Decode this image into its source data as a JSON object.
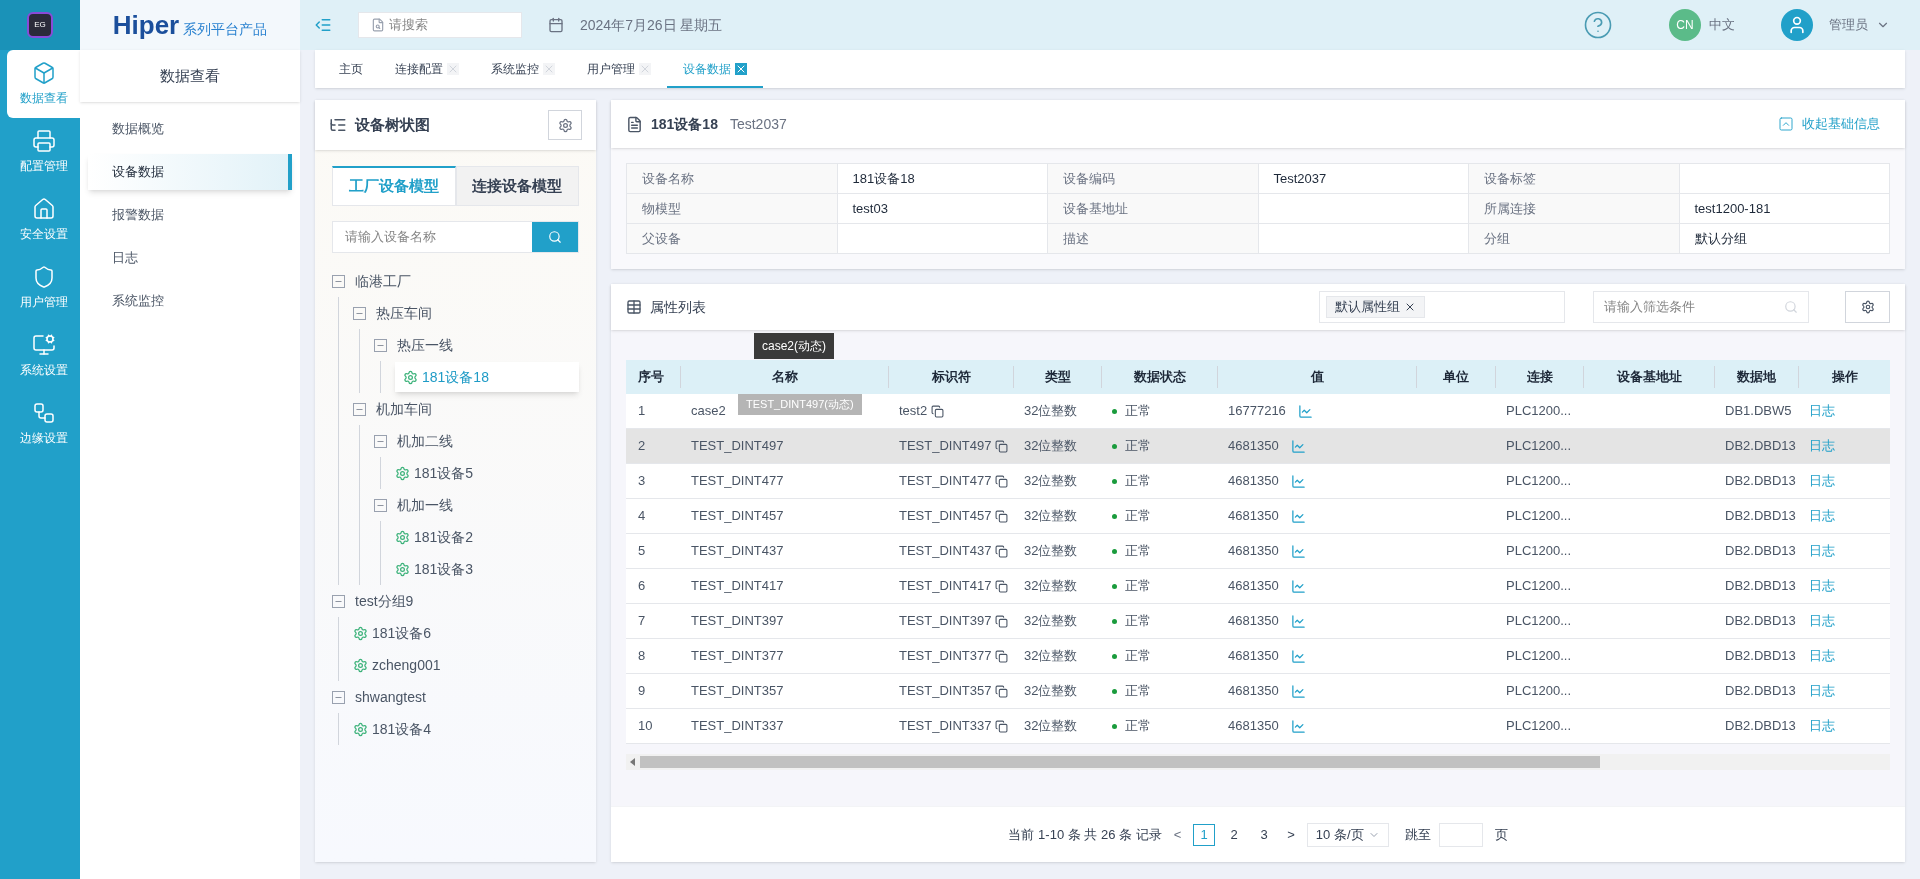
{
  "app_logo": {
    "text": "EG"
  },
  "brand": {
    "name": "Hiper",
    "subtitle": "系列平台产品"
  },
  "rail": [
    {
      "label": "数据查看",
      "selected": true
    },
    {
      "label": "配置管理",
      "selected": false
    },
    {
      "label": "安全设置",
      "selected": false
    },
    {
      "label": "用户管理",
      "selected": false
    },
    {
      "label": "系统设置",
      "selected": false
    },
    {
      "label": "边缘设置",
      "selected": false
    }
  ],
  "sidebar": {
    "title": "数据查看",
    "items": [
      {
        "label": "数据概览",
        "selected": false
      },
      {
        "label": "设备数据",
        "selected": true
      },
      {
        "label": "报警数据",
        "selected": false
      },
      {
        "label": "日志",
        "selected": false
      },
      {
        "label": "系统监控",
        "selected": false
      }
    ]
  },
  "top_bar": {
    "search": {
      "placeholder": "请搜索"
    },
    "date": "2024年7月26日 星期五",
    "language": {
      "badge": "CN",
      "label": "中文"
    },
    "user": "管理员"
  },
  "tabs": [
    {
      "label": "主页",
      "closable": false,
      "selected": false
    },
    {
      "label": "连接配置",
      "closable": true,
      "selected": false
    },
    {
      "label": "系统监控",
      "closable": true,
      "selected": false
    },
    {
      "label": "用户管理",
      "closable": true,
      "selected": false
    },
    {
      "label": "设备数据",
      "closable": true,
      "selected": true
    }
  ],
  "tree_panel": {
    "title": "设备树状图",
    "tabs": [
      {
        "label": "工厂设备模型",
        "selected": true
      },
      {
        "label": "连接设备模型",
        "selected": false
      }
    ],
    "search": {
      "placeholder": "请输入设备名称"
    },
    "tree": [
      {
        "label": "临港工厂",
        "kind": "group",
        "expanded": true,
        "selected": false,
        "children": [
          {
            "label": "热压车间",
            "kind": "group",
            "expanded": true,
            "selected": false,
            "children": [
              {
                "label": "热压一线",
                "kind": "group",
                "expanded": true,
                "selected": false,
                "children": [
                  {
                    "label": "181设备18",
                    "kind": "device",
                    "selected": true
                  }
                ]
              }
            ]
          },
          {
            "label": "机加车间",
            "kind": "group",
            "expanded": true,
            "selected": false,
            "children": [
              {
                "label": "机加二线",
                "kind": "group",
                "expanded": true,
                "selected": false,
                "children": [
                  {
                    "label": "181设备5",
                    "kind": "device",
                    "selected": false
                  }
                ]
              },
              {
                "label": "机加一线",
                "kind": "group",
                "expanded": true,
                "selected": false,
                "children": [
                  {
                    "label": "181设备2",
                    "kind": "device",
                    "selected": false
                  },
                  {
                    "label": "181设备3",
                    "kind": "device",
                    "selected": false
                  }
                ]
              }
            ]
          }
        ]
      },
      {
        "label": "test分组9",
        "kind": "group",
        "expanded": true,
        "selected": false,
        "children": [
          {
            "label": "181设备6",
            "kind": "device",
            "selected": false
          },
          {
            "label": "zcheng001",
            "kind": "device",
            "selected": false
          }
        ]
      },
      {
        "label": "shwangtest",
        "kind": "group",
        "expanded": true,
        "selected": false,
        "children": [
          {
            "label": "181设备4",
            "kind": "device",
            "selected": false
          }
        ]
      }
    ]
  },
  "device_info": {
    "title": "181设备18",
    "code": "Test2037",
    "collapse_label": "收起基础信息",
    "rows": [
      [
        {
          "label": "设备名称",
          "value": "181设备18"
        },
        {
          "label": "设备编码",
          "value": "Test2037"
        },
        {
          "label": "设备标签"
        }
      ],
      [
        {
          "label": "物模型",
          "value": "test03"
        },
        {
          "label": "设备基地址"
        },
        {
          "label": "所属连接",
          "value": "test1200-181"
        }
      ],
      [
        {
          "label": "父设备"
        },
        {
          "label": "描述"
        },
        {
          "label": "分组",
          "value": "默认分组"
        }
      ]
    ]
  },
  "properties": {
    "title": "属性列表",
    "group_tag": "默认属性组",
    "filter": {
      "placeholder": "请输入筛选条件"
    },
    "columns": [
      "序号",
      "名称",
      "标识符",
      "类型",
      "数据状态",
      "值",
      "单位",
      "连接",
      "设备基地址",
      "数据地",
      "操作"
    ],
    "tooltips": [
      "case2(动态)",
      "TEST_DINT497(动态)"
    ],
    "rows": [
      {
        "index": "1",
        "name": "case2",
        "identifier": "test2",
        "type": "32位整数",
        "status": "正常",
        "value": "16777216",
        "connection": "PLC1200...",
        "address": "DB1.DBW5",
        "action": "日志",
        "highlighted": false
      },
      {
        "index": "2",
        "name": "TEST_DINT497",
        "identifier": "TEST_DINT497",
        "type": "32位整数",
        "status": "正常",
        "value": "4681350",
        "connection": "PLC1200...",
        "address": "DB2.DBD13",
        "action": "日志",
        "highlighted": true
      },
      {
        "index": "3",
        "name": "TEST_DINT477",
        "identifier": "TEST_DINT477",
        "type": "32位整数",
        "status": "正常",
        "value": "4681350",
        "connection": "PLC1200...",
        "address": "DB2.DBD13",
        "action": "日志",
        "highlighted": false
      },
      {
        "index": "4",
        "name": "TEST_DINT457",
        "identifier": "TEST_DINT457",
        "type": "32位整数",
        "status": "正常",
        "value": "4681350",
        "connection": "PLC1200...",
        "address": "DB2.DBD13",
        "action": "日志",
        "highlighted": false
      },
      {
        "index": "5",
        "name": "TEST_DINT437",
        "identifier": "TEST_DINT437",
        "type": "32位整数",
        "status": "正常",
        "value": "4681350",
        "connection": "PLC1200...",
        "address": "DB2.DBD13",
        "action": "日志",
        "highlighted": false
      },
      {
        "index": "6",
        "name": "TEST_DINT417",
        "identifier": "TEST_DINT417",
        "type": "32位整数",
        "status": "正常",
        "value": "4681350",
        "connection": "PLC1200...",
        "address": "DB2.DBD13",
        "action": "日志",
        "highlighted": false
      },
      {
        "index": "7",
        "name": "TEST_DINT397",
        "identifier": "TEST_DINT397",
        "type": "32位整数",
        "status": "正常",
        "value": "4681350",
        "connection": "PLC1200...",
        "address": "DB2.DBD13",
        "action": "日志",
        "highlighted": false
      },
      {
        "index": "8",
        "name": "TEST_DINT377",
        "identifier": "TEST_DINT377",
        "type": "32位整数",
        "status": "正常",
        "value": "4681350",
        "connection": "PLC1200...",
        "address": "DB2.DBD13",
        "action": "日志",
        "highlighted": false
      },
      {
        "index": "9",
        "name": "TEST_DINT357",
        "identifier": "TEST_DINT357",
        "type": "32位整数",
        "status": "正常",
        "value": "4681350",
        "connection": "PLC1200...",
        "address": "DB2.DBD13",
        "action": "日志",
        "highlighted": false
      },
      {
        "index": "10",
        "name": "TEST_DINT337",
        "identifier": "TEST_DINT337",
        "type": "32位整数",
        "status": "正常",
        "value": "4681350",
        "connection": "PLC1200...",
        "address": "DB2.DBD13",
        "action": "日志",
        "highlighted": false
      }
    ]
  },
  "pagination": {
    "summary": "当前 1-10 条 共 26 条 记录",
    "prev": "<",
    "pages": [
      {
        "label": "1",
        "selected": true
      },
      {
        "label": "2",
        "selected": false
      },
      {
        "label": "3",
        "selected": false
      }
    ],
    "next": ">",
    "page_size": "10 条/页",
    "jump_label": "跳至",
    "page_suffix": "页"
  }
}
